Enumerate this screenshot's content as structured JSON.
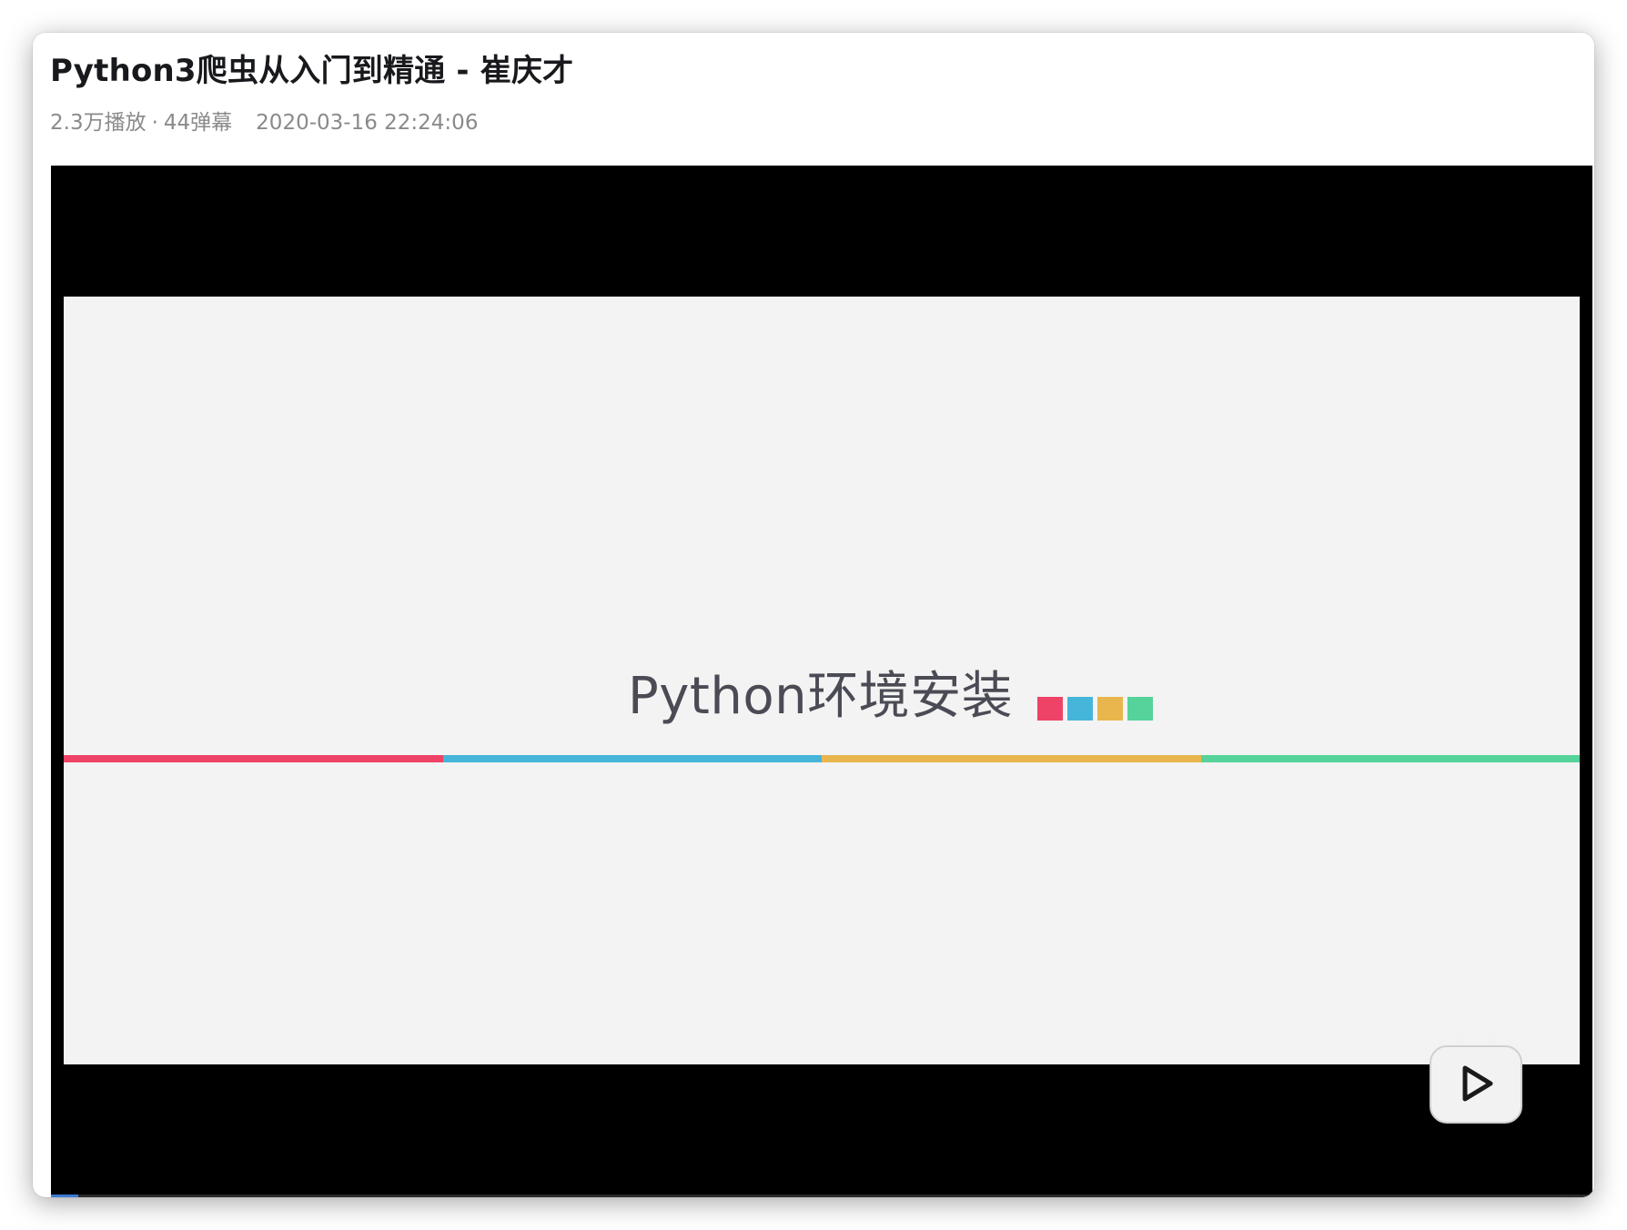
{
  "video": {
    "title": "Python3爬虫从入门到精通 - 崔庆才",
    "plays": "2.3万播放",
    "separator": "·",
    "danmaku": "44弹幕",
    "date": "2020-03-16 22:24:06"
  },
  "slide": {
    "heading": "Python环境安装",
    "square_colors": [
      "#ee4266",
      "#45b5da",
      "#e8b64c",
      "#55d39a"
    ],
    "stripe_colors": [
      "#ee4266",
      "#45b5da",
      "#e8b64c",
      "#55d39a"
    ]
  },
  "player": {
    "badge_icon": "bilibili-tv-play-icon",
    "progress": 0.018
  }
}
